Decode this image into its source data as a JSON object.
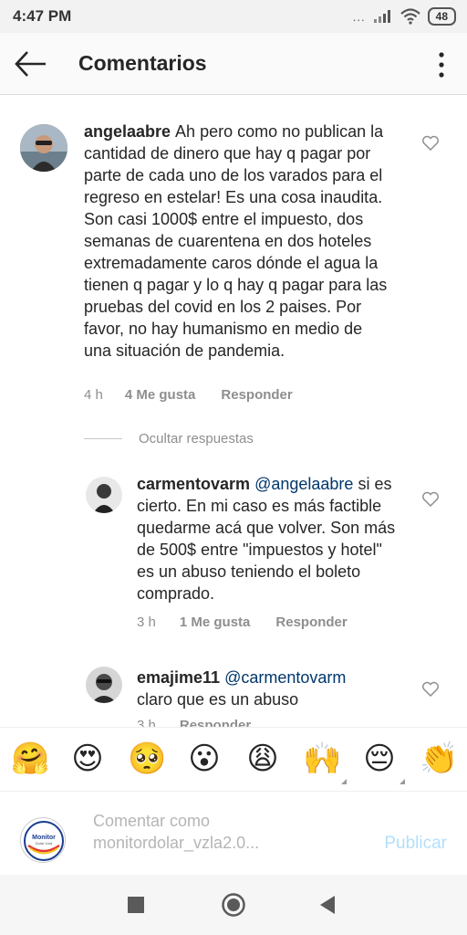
{
  "status_bar": {
    "time": "4:47 PM",
    "dots": "...",
    "battery": "48"
  },
  "header": {
    "title": "Comentarios",
    "back_icon": "arrow-left-icon",
    "more_icon": "more-vertical-icon"
  },
  "comments": [
    {
      "username": "angelaabre",
      "text": "Ah pero como no publican la cantidad de dinero que hay q pagar por parte de cada uno de los varados para el regreso en estelar! Es una cosa inaudita. Son casi 1000$ entre el impuesto, dos semanas de cuarentena en dos hoteles extremadamente caros dónde el agua la tienen q pagar y lo q hay q pagar para las pruebas del covid en los 2 paises. Por favor, no hay humanismo en medio de una situación de pandemia.",
      "time": "4 h",
      "likes": "4 Me gusta",
      "reply": "Responder"
    }
  ],
  "hide_replies": "Ocultar respuestas",
  "replies": [
    {
      "username": "carmentovarm",
      "mention": "@angelaabre",
      "text": "si es cierto. En mi caso es más factible quedarme acá que volver. Son más de 500$ entre \"impuestos y hotel\" es un abuso teniendo el boleto comprado.",
      "time": "3 h",
      "likes": "1 Me gusta",
      "reply": "Responder"
    },
    {
      "username": "emajime11",
      "mention": "@carmentovarm",
      "text": "claro que es un abuso",
      "time": "3 h",
      "reply": "Responder"
    }
  ],
  "emoji_bar": [
    {
      "char": "🤗",
      "name": "hugging-face-emoji"
    },
    {
      "char": "😍",
      "name": "heart-eyes-emoji"
    },
    {
      "char": "🥺",
      "name": "pleading-face-emoji"
    },
    {
      "char": "😮",
      "name": "surprised-face-emoji"
    },
    {
      "char": "😩",
      "name": "weary-face-emoji"
    },
    {
      "char": "🙌",
      "name": "raising-hands-emoji"
    },
    {
      "char": "😔",
      "name": "pensive-face-emoji"
    },
    {
      "char": "👏",
      "name": "clapping-hands-emoji"
    }
  ],
  "comment_input": {
    "placeholder": "Comentar como monitordolar_vzla2.0...",
    "publish_label": "Publicar"
  },
  "my_avatar": {
    "logo_text": "Monitor",
    "sub_text": "Dolar Vzla"
  },
  "colors": {
    "accent_link": "#00376b",
    "publish_disabled": "#b2dffc",
    "meta_gray": "#8e8e8e"
  }
}
